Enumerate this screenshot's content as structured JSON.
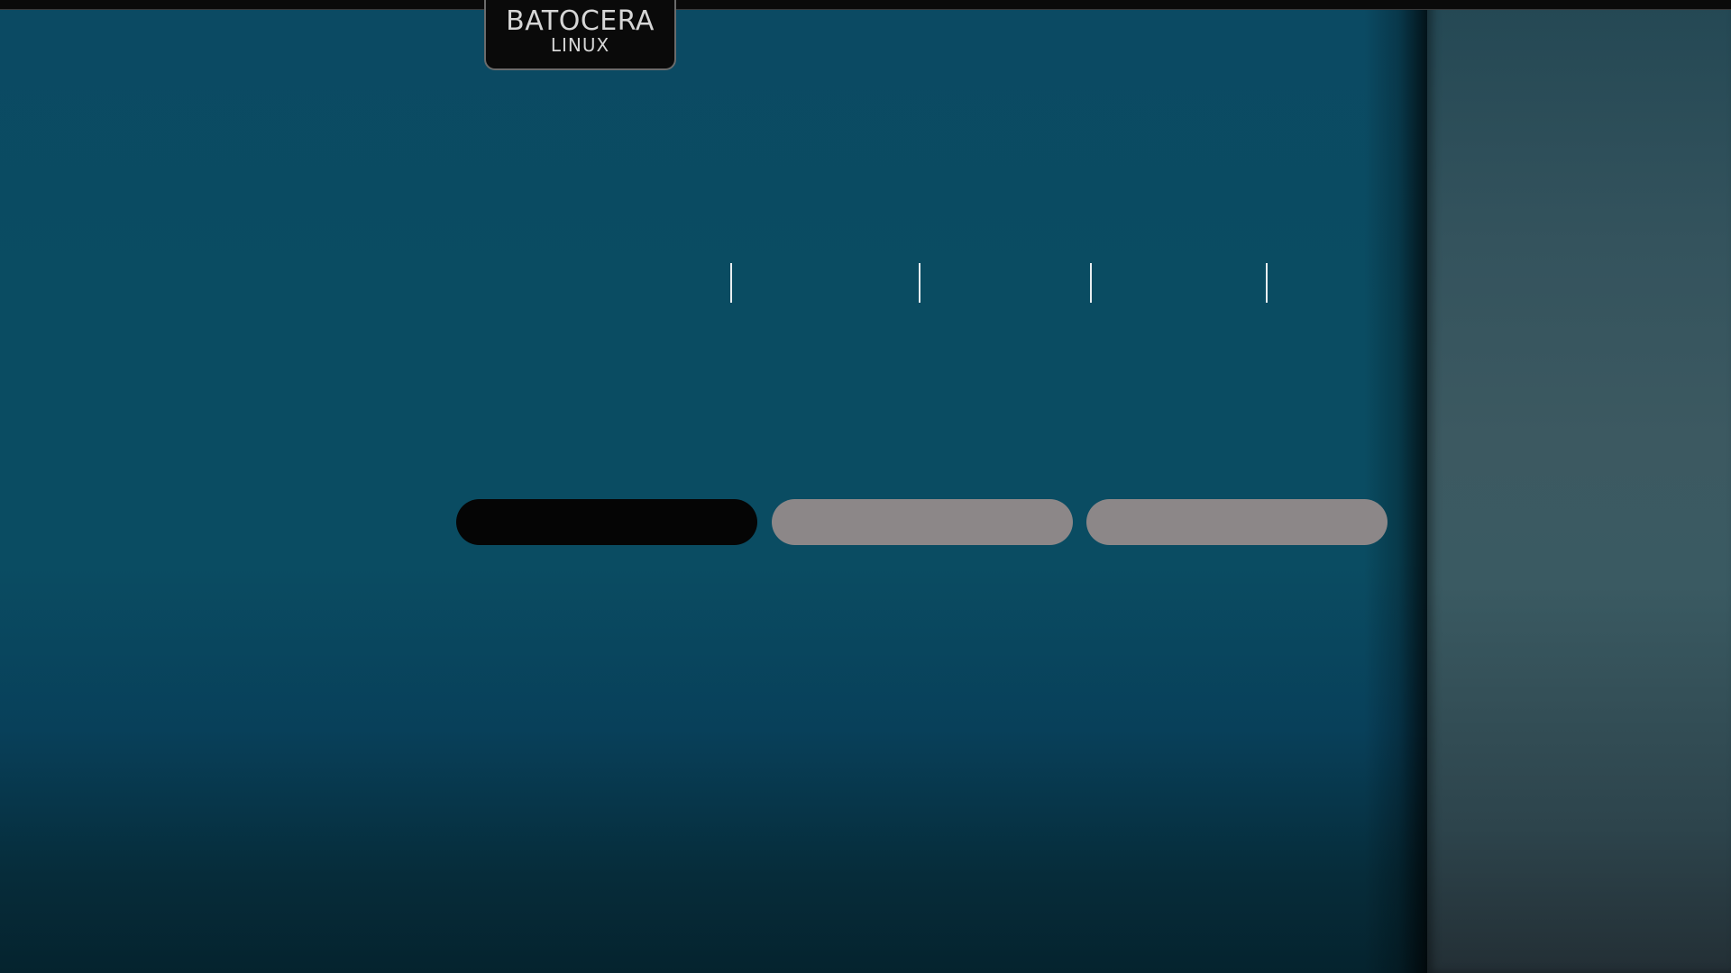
{
  "app": {
    "logo": {
      "main_text": "BATOCERA",
      "sub_text": "LINUX"
    }
  },
  "view": {
    "tab_separators": 4,
    "pills": [
      {
        "state": "selected",
        "color": "#050505"
      },
      {
        "state": "normal",
        "color": "#8c8788"
      },
      {
        "state": "normal",
        "color": "#8c8788"
      }
    ]
  },
  "colors": {
    "background": "#0a4c62",
    "side_panel": "#3a5a62",
    "top_bar": "#0a0a0a",
    "logo_text": "#d6d6d6",
    "separator": "#e8eef0"
  }
}
